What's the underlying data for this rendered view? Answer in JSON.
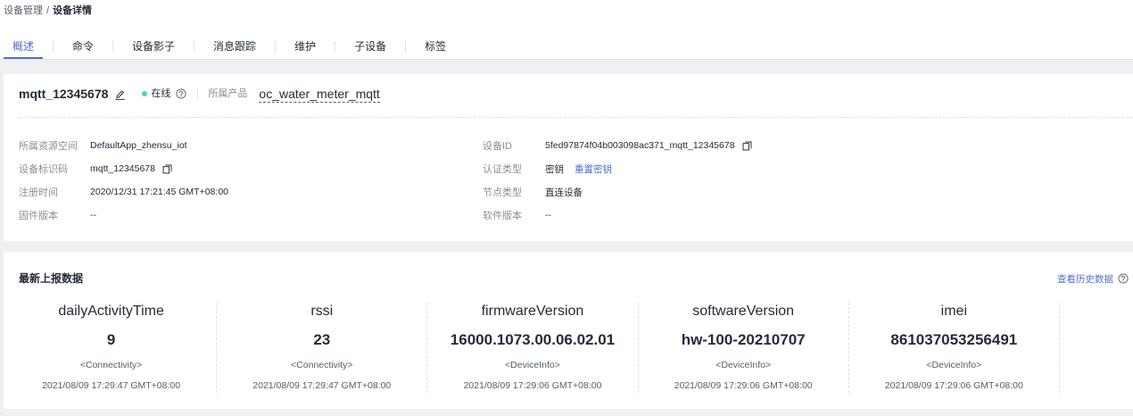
{
  "colors": {
    "accent": "#526ecc",
    "online": "#50d4ab"
  },
  "breadcrumb": {
    "parent": "设备管理",
    "separator": "/",
    "current": "设备详情"
  },
  "tabs": [
    {
      "label": "概述",
      "active": true
    },
    {
      "label": "命令",
      "active": false
    },
    {
      "label": "设备影子",
      "active": false
    },
    {
      "label": "消息跟踪",
      "active": false
    },
    {
      "label": "维护",
      "active": false
    },
    {
      "label": "子设备",
      "active": false
    },
    {
      "label": "标签",
      "active": false
    }
  ],
  "device": {
    "name": "mqtt_12345678",
    "edit_icon": "edit-icon",
    "status": "在线",
    "status_icon": "online-dot-icon",
    "status_help_icon": "help-icon",
    "product_label": "所属产品",
    "product_name": "oc_water_meter_mqtt"
  },
  "info": {
    "left": [
      {
        "label": "所属资源空间",
        "value": "DefaultApp_zhensu_iot"
      },
      {
        "label": "设备标识码",
        "value": "mqtt_12345678",
        "icon": "copy-icon"
      },
      {
        "label": "注册时间",
        "value": "2020/12/31 17:21:45 GMT+08:00"
      },
      {
        "label": "固件版本",
        "value": "--"
      }
    ],
    "right": [
      {
        "label": "设备ID",
        "value": "5fed97874f04b003098ac371_mqtt_12345678",
        "icon": "copy-icon"
      },
      {
        "label": "认证类型",
        "value": "密钥",
        "action": "重置密钥"
      },
      {
        "label": "节点类型",
        "value": "直连设备"
      },
      {
        "label": "软件版本",
        "value": "--"
      }
    ]
  },
  "latest": {
    "title": "最新上报数据",
    "history_link": "查看历史数据",
    "help_icon": "help-icon",
    "items": [
      {
        "name": "dailyActivityTime",
        "value": "9",
        "service": "<Connectivity>",
        "time": "2021/08/09 17:29:47 GMT+08:00"
      },
      {
        "name": "rssi",
        "value": "23",
        "service": "<Connectivity>",
        "time": "2021/08/09 17:29:47 GMT+08:00"
      },
      {
        "name": "firmwareVersion",
        "value": "16000.1073.00.06.02.01",
        "service": "<DeviceInfo>",
        "time": "2021/08/09 17:29:06 GMT+08:00"
      },
      {
        "name": "softwareVersion",
        "value": "hw-100-20210707",
        "service": "<DeviceInfo>",
        "time": "2021/08/09 17:29:06 GMT+08:00"
      },
      {
        "name": "imei",
        "value": "861037053256491",
        "service": "<DeviceInfo>",
        "time": "2021/08/09 17:29:06 GMT+08:00"
      }
    ]
  }
}
